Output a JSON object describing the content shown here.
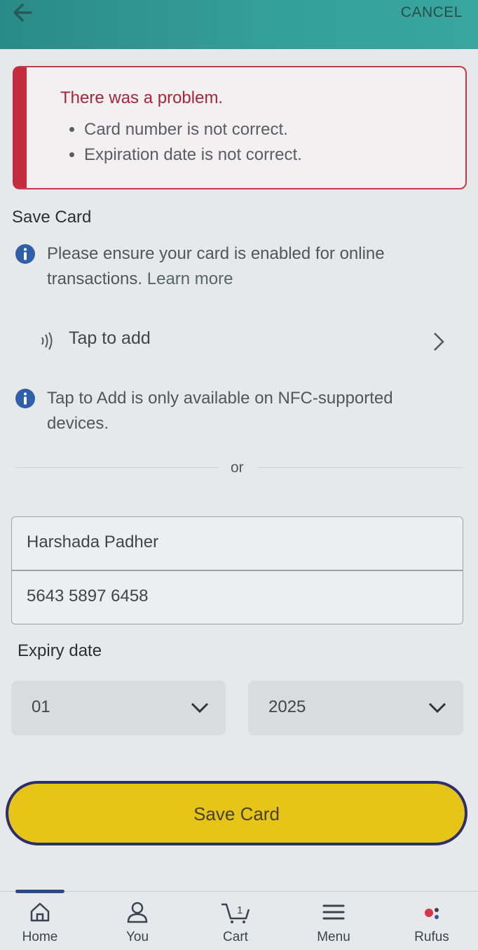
{
  "header": {
    "cancel_label": "CANCEL"
  },
  "error": {
    "title": "There was a problem.",
    "items": [
      "Card number is not correct.",
      "Expiration date is not correct."
    ]
  },
  "save_card": {
    "title": "Save Card",
    "info_text": "Please ensure your card is enabled for online transactions.",
    "learn_more": "Learn more",
    "tap_to_add": "Tap to add",
    "nfc_note": "Tap to Add is only available on NFC-supported devices.",
    "or": "or"
  },
  "form": {
    "name_value": "Harshada Padher",
    "card_number_value": "5643 5897 6458",
    "expiry_label": "Expiry date",
    "month_value": "01",
    "year_value": "2025",
    "submit_label": "Save Card"
  },
  "nav": {
    "items": [
      {
        "label": "Home",
        "icon": "home-icon"
      },
      {
        "label": "You",
        "icon": "user-icon"
      },
      {
        "label": "Cart",
        "icon": "cart-icon",
        "badge": "1"
      },
      {
        "label": "Menu",
        "icon": "menu-icon"
      },
      {
        "label": "Rufus",
        "icon": "rufus-icon"
      }
    ]
  },
  "colors": {
    "header": "#35a09a",
    "error_accent": "#c42b3e",
    "info_icon": "#2f5fa8",
    "button": "#e6c418",
    "button_border": "#2b2f6e"
  }
}
